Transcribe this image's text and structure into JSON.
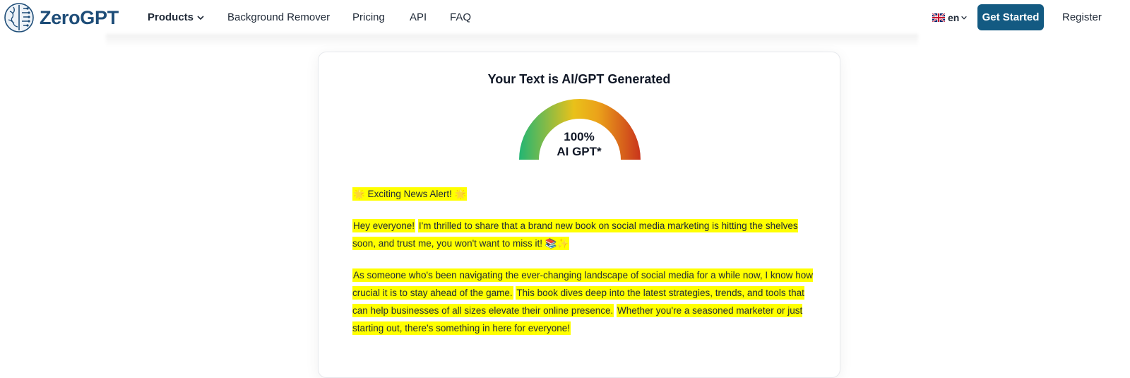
{
  "header": {
    "logo_text": "ZeroGPT",
    "nav": [
      {
        "label": "Products",
        "has_dropdown": true
      },
      {
        "label": "Background Remover"
      },
      {
        "label": "Pricing"
      },
      {
        "label": "API"
      },
      {
        "label": "FAQ"
      }
    ],
    "language": "en",
    "get_started_label": "Get Started",
    "register_label": "Register"
  },
  "result": {
    "title": "Your Text is AI/GPT Generated",
    "score": "100%",
    "score_label": "AI GPT*",
    "gauge_percent": 100,
    "paragraphs": [
      {
        "segments": [
          {
            "text": "🌟 Exciting News Alert! 🌟",
            "highlighted": true
          }
        ]
      },
      {
        "segments": [
          {
            "text": "Hey everyone!",
            "highlighted": true
          },
          {
            "text": " ",
            "highlighted": false
          },
          {
            "text": "I'm thrilled to share that a brand new book on social media marketing is hitting the shelves soon, and trust me, you won't want to miss it! 📚✨",
            "highlighted": true
          }
        ]
      },
      {
        "segments": [
          {
            "text": "As someone who's been navigating the ever-changing landscape of social media for a while now, I know how crucial it is to stay ahead of the game.",
            "highlighted": true
          },
          {
            "text": " ",
            "highlighted": false
          },
          {
            "text": "This book dives deep into the latest strategies, trends, and tools that can help businesses of all sizes elevate their online presence.",
            "highlighted": true
          },
          {
            "text": " ",
            "highlighted": false
          },
          {
            "text": "Whether you're a seasoned marketer or just starting out, there's something in here for everyone!",
            "highlighted": true
          }
        ]
      }
    ]
  },
  "colors": {
    "brand": "#1e4d78",
    "button": "#135a82",
    "highlight": "#ffff00",
    "gauge_low": "#22b573",
    "gauge_mid": "#f2c10f",
    "gauge_high": "#c9341c"
  },
  "icons": [
    "brain-logo-icon",
    "chevron-down-icon",
    "uk-flag-icon"
  ]
}
